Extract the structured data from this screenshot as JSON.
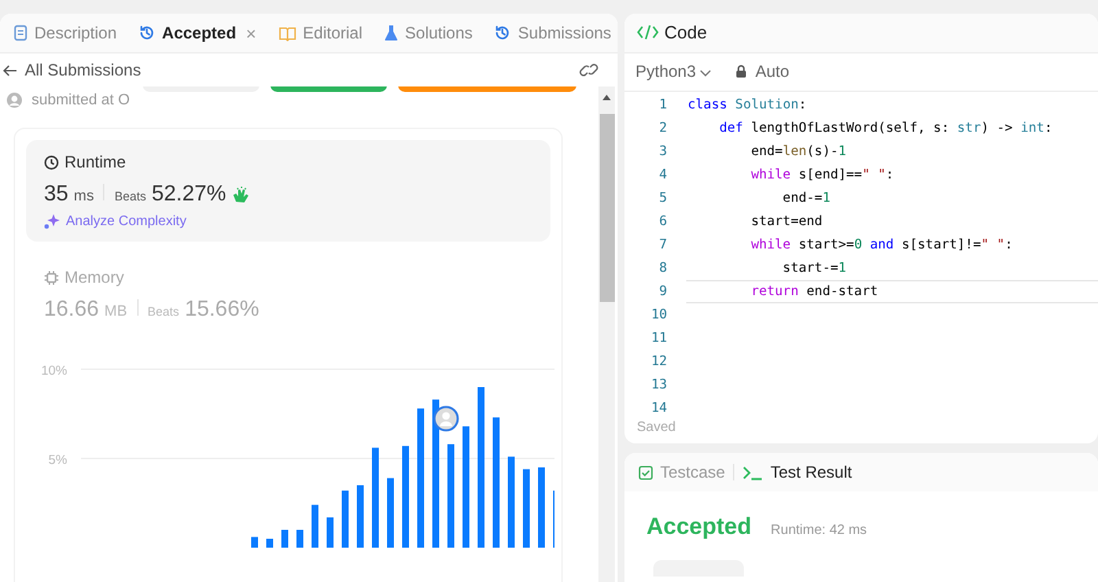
{
  "left_panel": {
    "tabs": [
      {
        "label": "Description",
        "selected": false,
        "closable": false
      },
      {
        "label": "Accepted",
        "selected": true,
        "closable": true,
        "close": "×"
      },
      {
        "label": "Editorial",
        "selected": false,
        "closable": false
      },
      {
        "label": "Solutions",
        "selected": false,
        "closable": false
      },
      {
        "label": "Submissions",
        "selected": false,
        "closable": false
      }
    ],
    "back_link": "All Submissions",
    "submitted_text": "submitted at O",
    "stat_cards": [
      {
        "title": "Runtime",
        "value": "35",
        "unit": "ms",
        "beats_label": "Beats",
        "beats": "52.27%",
        "selected": true,
        "action": "Analyze Complexity"
      },
      {
        "title": "Memory",
        "value": "16.66",
        "unit": "MB",
        "beats_label": "Beats",
        "beats": "15.66%",
        "selected": false
      }
    ],
    "chart_data": {
      "type": "bar",
      "yticks": [
        {
          "value": 5,
          "label": "5%"
        },
        {
          "value": 10,
          "label": "10%"
        }
      ],
      "ylim": [
        0,
        10
      ],
      "values": [
        null,
        null,
        null,
        null,
        null,
        null,
        null,
        null,
        null,
        null,
        null,
        0.6,
        0.5,
        1.0,
        1.0,
        2.4,
        1.7,
        3.2,
        3.5,
        5.6,
        3.9,
        5.7,
        7.8,
        8.3,
        5.8,
        6.8,
        9.0,
        7.3,
        5.1,
        4.4,
        4.5,
        3.2
      ]
    }
  },
  "code_panel": {
    "title": "Code",
    "language": "Python3",
    "mode": "Auto",
    "status": "Saved",
    "lines": [
      {
        "number": "1",
        "current": false,
        "tokens": [
          {
            "kind": "keyword",
            "text": "class"
          },
          {
            "kind": "type",
            "text": " Solution"
          },
          {
            "kind": "plain",
            "text": ":"
          }
        ]
      },
      {
        "number": "2",
        "current": false,
        "tokens": [
          {
            "kind": "keyword",
            "text": "    def"
          },
          {
            "kind": "plain",
            "text": " lengthOfLastWord(self, s: "
          },
          {
            "kind": "type",
            "text": "str"
          },
          {
            "kind": "plain",
            "text": ") -> "
          },
          {
            "kind": "type",
            "text": "int"
          },
          {
            "kind": "plain",
            "text": ":"
          }
        ]
      },
      {
        "number": "3",
        "current": false,
        "tokens": [
          {
            "kind": "plain",
            "text": "        end="
          },
          {
            "kind": "function",
            "text": "len"
          },
          {
            "kind": "plain",
            "text": "(s)-"
          },
          {
            "kind": "number",
            "text": "1"
          }
        ]
      },
      {
        "number": "4",
        "current": false,
        "tokens": [
          {
            "kind": "control",
            "text": "        while"
          },
          {
            "kind": "plain",
            "text": " s[end]=="
          },
          {
            "kind": "string",
            "text": "\" \""
          },
          {
            "kind": "plain",
            "text": ":"
          }
        ]
      },
      {
        "number": "5",
        "current": false,
        "tokens": [
          {
            "kind": "plain",
            "text": "            end-="
          },
          {
            "kind": "number",
            "text": "1"
          }
        ]
      },
      {
        "number": "6",
        "current": false,
        "tokens": [
          {
            "kind": "plain",
            "text": "        start=end"
          }
        ]
      },
      {
        "number": "7",
        "current": false,
        "tokens": [
          {
            "kind": "control",
            "text": "        while"
          },
          {
            "kind": "plain",
            "text": " start>="
          },
          {
            "kind": "number",
            "text": "0"
          },
          {
            "kind": "keyword",
            "text": " and"
          },
          {
            "kind": "plain",
            "text": " s[start]!="
          },
          {
            "kind": "string",
            "text": "\" \""
          },
          {
            "kind": "plain",
            "text": ":"
          }
        ]
      },
      {
        "number": "8",
        "current": false,
        "tokens": [
          {
            "kind": "plain",
            "text": "            start-="
          },
          {
            "kind": "number",
            "text": "1"
          }
        ]
      },
      {
        "number": "9",
        "current": true,
        "tokens": [
          {
            "kind": "control",
            "text": "        return"
          },
          {
            "kind": "plain",
            "text": " end-start"
          }
        ]
      },
      {
        "number": "10",
        "current": false
      },
      {
        "number": "11",
        "current": false
      },
      {
        "number": "12",
        "current": false
      },
      {
        "number": "13",
        "current": false
      },
      {
        "number": "14",
        "current": false
      }
    ]
  },
  "result_panel": {
    "tabs": [
      {
        "label": "Testcase",
        "selected": false
      },
      {
        "label": "Test Result",
        "selected": true
      }
    ],
    "verdict": "Accepted",
    "runtime": "Runtime: 42 ms"
  }
}
